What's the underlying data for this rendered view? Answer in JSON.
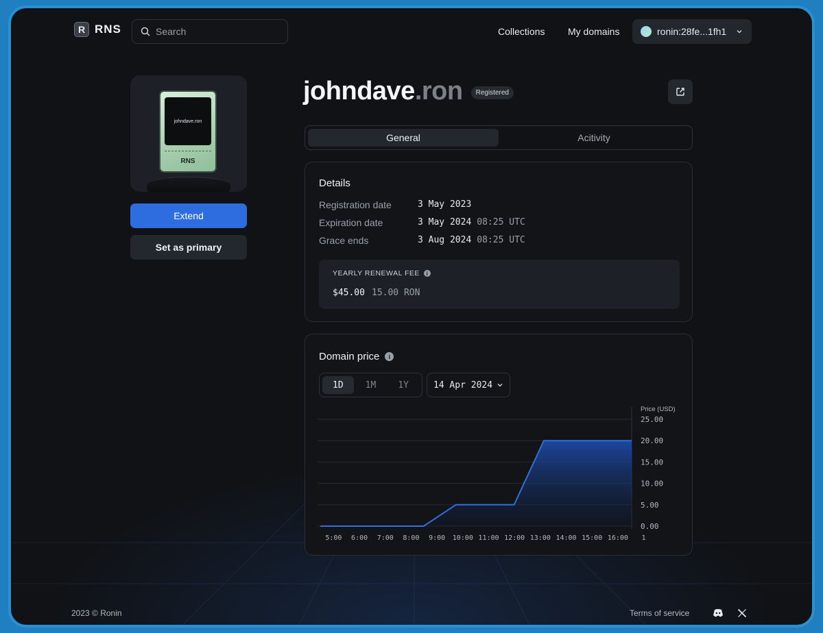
{
  "header": {
    "logo_text": "RNS",
    "logo_mark": "R",
    "search_placeholder": "Search",
    "nav": [
      {
        "label": "Collections"
      },
      {
        "label": "My domains"
      }
    ],
    "wallet_label": "ronin:28fe...1fh1"
  },
  "card": {
    "nft_domain": "johndave.ron",
    "nft_label": "RNS"
  },
  "actions": {
    "extend_label": "Extend",
    "set_primary_label": "Set as primary"
  },
  "domain": {
    "name": "johndave",
    "tld": ".ron",
    "status": "Registered"
  },
  "tabs": [
    {
      "label": "General",
      "active": true
    },
    {
      "label": "Acitivity",
      "active": false
    }
  ],
  "details": {
    "title": "Details",
    "rows": [
      {
        "label": "Registration date",
        "date": "3 May 2023",
        "time": ""
      },
      {
        "label": "Expiration date",
        "date": "3 May 2024",
        "time": "08:25 UTC"
      },
      {
        "label": "Grace ends",
        "date": "3 Aug 2024",
        "time": "08:25 UTC"
      }
    ],
    "fee": {
      "label": "YEARLY RENEWAL FEE",
      "usd": "$45.00",
      "ron": "15.00 RON"
    }
  },
  "price": {
    "title": "Domain price",
    "ranges": [
      {
        "label": "1D",
        "active": true
      },
      {
        "label": "1M",
        "active": false
      },
      {
        "label": "1Y",
        "active": false
      }
    ],
    "date_label": "14 Apr 2024"
  },
  "chart_data": {
    "type": "area",
    "ylabel": "Price (USD)",
    "ylim": [
      0,
      25
    ],
    "yticks": [
      "25.00",
      "20.00",
      "15.00",
      "10.00",
      "5.00",
      "0.00"
    ],
    "x": [
      "5:00",
      "6:00",
      "7:00",
      "8:00",
      "9:00",
      "10:00",
      "11:00",
      "12:00",
      "13:00",
      "14:00",
      "15:00",
      "16:00",
      "1"
    ],
    "points": [
      {
        "x": 4.75,
        "y": 0
      },
      {
        "x": 8.75,
        "y": 0
      },
      {
        "x": 10,
        "y": 5
      },
      {
        "x": 12.25,
        "y": 5
      },
      {
        "x": 13.4,
        "y": 20
      },
      {
        "x": 16.8,
        "y": 20
      }
    ],
    "color": "#2f6fe0",
    "grid": true
  },
  "footer": {
    "copyright": "2023 © Ronin",
    "terms": "Terms of service"
  },
  "colors": {
    "accent": "#2e6de0",
    "background": "#101215",
    "frame": "#2b8fd1"
  }
}
